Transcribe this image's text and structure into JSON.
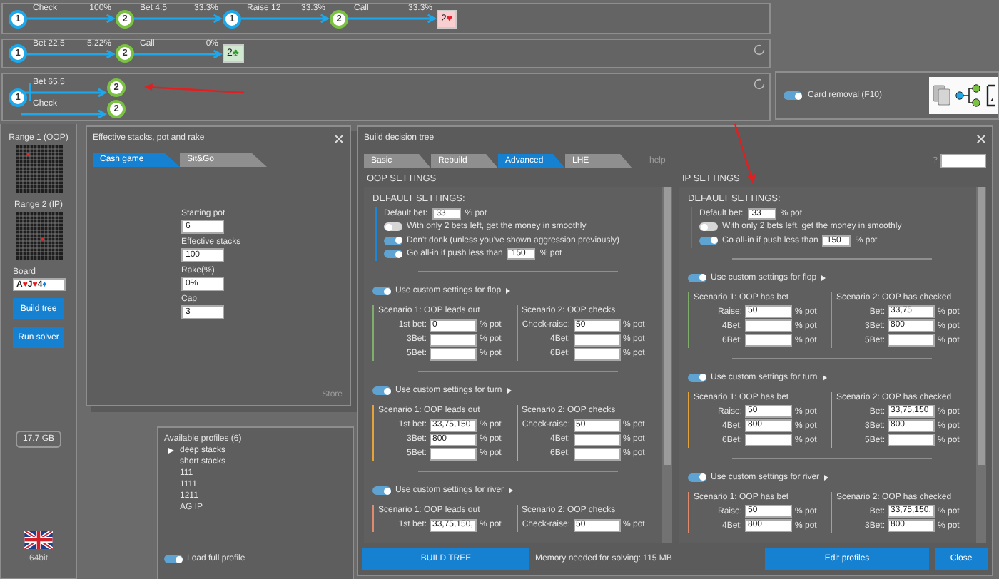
{
  "lines": [
    {
      "kind": "chain",
      "busy": false,
      "start": {
        "label": "1",
        "color": "#1ea8ec"
      },
      "steps": [
        {
          "action": "Check",
          "share": "100%",
          "node": {
            "label": "2",
            "color": "#7cc242"
          }
        },
        {
          "action": "Bet 4.5",
          "share": "33.3%",
          "node": {
            "label": "1",
            "color": "#1ea8ec"
          }
        },
        {
          "action": "Raise 12",
          "share": "33.3%",
          "node": {
            "label": "2",
            "color": "#7cc242"
          }
        },
        {
          "action": "Call",
          "share": "33.3%"
        }
      ],
      "card": {
        "rank": "2",
        "suit": "♥",
        "color": "#e0202a"
      }
    },
    {
      "kind": "chain",
      "busy": true,
      "start": {
        "label": "1",
        "color": "#1ea8ec"
      },
      "steps": [
        {
          "action": "Bet 22.5",
          "share": "5.22%",
          "node": {
            "label": "2",
            "color": "#7cc242"
          }
        },
        {
          "action": "Call",
          "share": "0%"
        }
      ],
      "card": {
        "rank": "2",
        "suit": "♣",
        "color": "#2f9a2f"
      }
    },
    {
      "kind": "branch",
      "busy": true,
      "start": {
        "label": "1",
        "color": "#1ea8ec"
      },
      "branches": [
        {
          "action": "Bet 65.5",
          "node": {
            "label": "2",
            "color": "#7cc242"
          }
        },
        {
          "action": "Check",
          "node": {
            "label": "2",
            "color": "#7cc242"
          }
        }
      ]
    }
  ],
  "card_removal": {
    "label": "Card removal (F10)",
    "on": true
  },
  "sidebar": {
    "ranges": [
      {
        "label": "Range 1 (OOP)"
      },
      {
        "label": "Range 2 (IP)"
      }
    ],
    "board_label": "Board",
    "board": [
      {
        "rank": "A",
        "suit": "♥",
        "color": "#e01b1b"
      },
      {
        "rank": "J",
        "suit": "♥",
        "color": "#e01b1b"
      },
      {
        "rank": "4",
        "suit": "♦",
        "color": "#1e7fd6"
      }
    ],
    "buttons": [
      "Build tree",
      "Run solver"
    ],
    "memory": "17.7 GB",
    "build": "64bit"
  },
  "stacks_window": {
    "title": "Effective stacks, pot and rake",
    "tabs": [
      {
        "label": "Cash game",
        "selected": true
      },
      {
        "label": "Sit&Go",
        "selected": false
      }
    ],
    "fields": [
      {
        "label": "Starting pot",
        "value": "6"
      },
      {
        "label": "Effective stacks",
        "value": "100"
      },
      {
        "label": "Rake(%)",
        "value": "0%"
      },
      {
        "label": "Cap",
        "value": "3"
      }
    ],
    "store": "Store"
  },
  "profiles": {
    "title": "Available profiles (6)",
    "items": [
      {
        "label": "deep stacks",
        "selected": true
      },
      {
        "label": "short stacks",
        "selected": false
      },
      {
        "label": "111",
        "selected": false
      },
      {
        "label": "1111",
        "selected": false
      },
      {
        "label": "1211",
        "selected": false
      },
      {
        "label": "AG IP",
        "selected": false
      }
    ],
    "toggle": {
      "label": "Load full profile",
      "on": true
    }
  },
  "tree_dialog": {
    "title": "Build decision tree",
    "tabs": [
      {
        "label": "Basic",
        "selected": false
      },
      {
        "label": "Rebuild",
        "selected": false
      },
      {
        "label": "Advanced",
        "selected": true
      },
      {
        "label": "LHE",
        "selected": false
      }
    ],
    "help": "help",
    "hint": "?",
    "sections": [
      {
        "title": "OOP SETTINGS",
        "defaults": {
          "title": "DEFAULT SETTINGS:",
          "rows": [
            {
              "kind": "input",
              "label": "Default bet:",
              "value": "33",
              "unit": "% pot"
            },
            {
              "kind": "toggle",
              "label": "With only 2 bets left, get the money in smoothly",
              "on": false
            },
            {
              "kind": "toggle",
              "label": "Don't donk (unless you've shown aggression previously)",
              "on": true
            },
            {
              "kind": "toggle_input",
              "label": "Go all-in if push less than",
              "on": true,
              "value": "150",
              "unit": "% pot"
            }
          ]
        },
        "streets": [
          {
            "label": "Use custom settings for flop",
            "on": true,
            "color": "#7fae6a",
            "scenarios": [
              {
                "title": "Scenario 1: OOP leads out",
                "rows": [
                  {
                    "label": "1st bet:",
                    "value": "0",
                    "unit": "% pot"
                  },
                  {
                    "label": "3Bet:",
                    "unit": "% pot"
                  },
                  {
                    "label": "5Bet:",
                    "unit": "% pot"
                  }
                ]
              },
              {
                "title": "Scenario 2: OOP checks",
                "rows": [
                  {
                    "label": "Check-raise:",
                    "value": "50",
                    "unit": "% pot"
                  },
                  {
                    "label": "4Bet:",
                    "unit": "% pot"
                  },
                  {
                    "label": "6Bet:",
                    "unit": "% pot"
                  }
                ]
              }
            ]
          },
          {
            "label": "Use custom settings for turn",
            "on": true,
            "color": "#e3a33a",
            "scenarios": [
              {
                "title": "Scenario 1: OOP leads out",
                "rows": [
                  {
                    "label": "1st bet:",
                    "value": "33,75,150",
                    "unit": "% pot"
                  },
                  {
                    "label": "3Bet:",
                    "value": "800",
                    "unit": "% pot"
                  },
                  {
                    "label": "5Bet:",
                    "unit": "% pot"
                  }
                ]
              },
              {
                "title": "Scenario 2: OOP checks",
                "rows": [
                  {
                    "label": "Check-raise:",
                    "value": "50",
                    "unit": "% pot"
                  },
                  {
                    "label": "4Bet:",
                    "unit": "% pot"
                  },
                  {
                    "label": "6Bet:",
                    "unit": "% pot"
                  }
                ]
              }
            ]
          },
          {
            "label": "Use custom settings for river",
            "on": true,
            "color": "#e08a6e",
            "scenarios": [
              {
                "title": "Scenario 1: OOP leads out",
                "rows": [
                  {
                    "label": "1st bet:",
                    "value": "33,75,150,",
                    "unit": "% pot"
                  }
                ]
              },
              {
                "title": "Scenario 2: OOP checks",
                "rows": [
                  {
                    "label": "Check-raise:",
                    "value": "50",
                    "unit": "% pot"
                  }
                ]
              }
            ]
          }
        ]
      },
      {
        "title": "IP SETTINGS",
        "defaults": {
          "title": "DEFAULT SETTINGS:",
          "rows": [
            {
              "kind": "input",
              "label": "Default bet:",
              "value": "33",
              "unit": "% pot"
            },
            {
              "kind": "toggle",
              "label": "With only 2 bets left, get the money in smoothly",
              "on": false
            },
            {
              "kind": "toggle_input",
              "label": "Go all-in if push less than",
              "on": true,
              "value": "150",
              "unit": "% pot"
            }
          ]
        },
        "streets": [
          {
            "label": "Use custom settings for flop",
            "on": true,
            "color": "#7fae6a",
            "scenarios": [
              {
                "title": "Scenario 1: OOP has bet",
                "rows": [
                  {
                    "label": "Raise:",
                    "value": "50",
                    "unit": "% pot"
                  },
                  {
                    "label": "4Bet:",
                    "unit": "% pot"
                  },
                  {
                    "label": "6Bet:",
                    "unit": "% pot"
                  }
                ]
              },
              {
                "title": "Scenario 2: OOP has checked",
                "rows": [
                  {
                    "label": "Bet:",
                    "value": "33,75",
                    "unit": "% pot"
                  },
                  {
                    "label": "3Bet:",
                    "value": "800",
                    "unit": "% pot"
                  },
                  {
                    "label": "5Bet:",
                    "unit": "% pot"
                  }
                ]
              }
            ]
          },
          {
            "label": "Use custom settings for turn",
            "on": true,
            "color": "#e3a33a",
            "scenarios": [
              {
                "title": "Scenario 1: OOP has bet",
                "rows": [
                  {
                    "label": "Raise:",
                    "value": "50",
                    "unit": "% pot"
                  },
                  {
                    "label": "4Bet:",
                    "value": "800",
                    "unit": "% pot"
                  },
                  {
                    "label": "6Bet:",
                    "unit": "% pot"
                  }
                ]
              },
              {
                "title": "Scenario 2: OOP has checked",
                "rows": [
                  {
                    "label": "Bet:",
                    "value": "33,75,150",
                    "unit": "% pot"
                  },
                  {
                    "label": "3Bet:",
                    "value": "800",
                    "unit": "% pot"
                  },
                  {
                    "label": "5Bet:",
                    "unit": "% pot"
                  }
                ]
              }
            ]
          },
          {
            "label": "Use custom settings for river",
            "on": true,
            "color": "#e08a6e",
            "scenarios": [
              {
                "title": "Scenario 1: OOP has bet",
                "rows": [
                  {
                    "label": "Raise:",
                    "value": "50",
                    "unit": "% pot"
                  },
                  {
                    "label": "4Bet:",
                    "value": "800",
                    "unit": "% pot"
                  }
                ]
              },
              {
                "title": "Scenario 2: OOP has checked",
                "rows": [
                  {
                    "label": "Bet:",
                    "value": "33,75,150,",
                    "unit": "% pot"
                  },
                  {
                    "label": "3Bet:",
                    "value": "800",
                    "unit": "% pot"
                  }
                ]
              }
            ]
          }
        ]
      }
    ],
    "build_button": "BUILD TREE",
    "memory": "Memory needed for solving: 115 MB",
    "buttons": [
      "Edit profiles",
      "Close"
    ]
  }
}
